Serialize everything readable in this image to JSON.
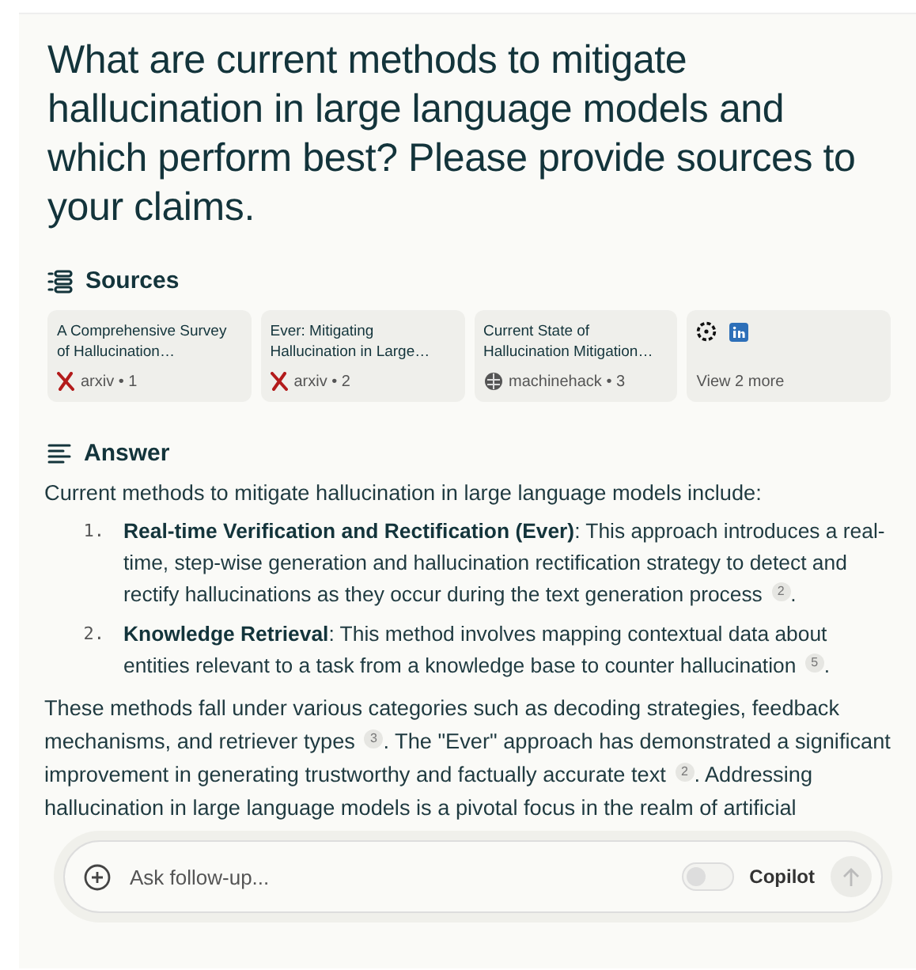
{
  "question": "What are current methods to mitigate hallucination in large language models and which perform best? Please provide sources to your claims.",
  "sources": {
    "title": "Sources",
    "cards": [
      {
        "kind": "paper",
        "title": "A Comprehensive Survey of Hallucination…",
        "meta": "arxiv • 1"
      },
      {
        "kind": "paper",
        "title": "Ever: Mitigating Hallucination in Large…",
        "meta": "arxiv • 2"
      },
      {
        "kind": "web",
        "title": "Current State of Hallucination Mitigation…",
        "meta": "machinehack • 3"
      },
      {
        "kind": "more",
        "label": "View 2 more"
      }
    ]
  },
  "answer": {
    "title": "Answer",
    "intro": "Current methods to mitigate hallucination in large language models include:",
    "items": [
      {
        "marker": "1.",
        "text": "**Real-time Verification and Rectification (Ever)**: This approach introduces a real-time, step-wise generation and hallucination rectification strategy to detect and rectify hallucinations as they occur during the text generation process $^{2}$."
      },
      {
        "marker": "2.",
        "text": "**Knowledge Retrieval**: This method involves mapping contextual data about entities relevant to a task from a knowledge base to counter hallucination $^{5}$."
      }
    ],
    "outro": "These methods fall under various categories such as decoding strategies, feedback mechanisms, and retriever types $^{3}$. The \"Ever\" approach has demonstrated a significant improvement in generating trustworthy and factually accurate text $^{2}$. Addressing hallucination in large language models is a pivotal focus in the realm of artificial"
  },
  "composer": {
    "placeholder": "Ask follow-up...",
    "copilot_label": "Copilot",
    "copilot_on": false
  }
}
